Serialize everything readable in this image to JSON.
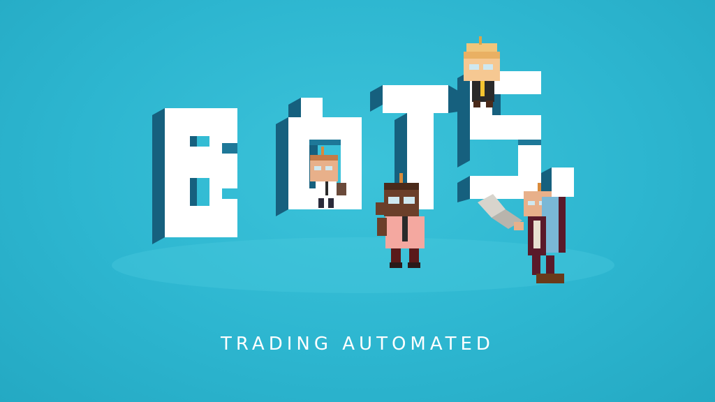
{
  "scene": {
    "logo_word": "BOTS",
    "tagline": "TRADING AUTOMATED"
  },
  "colors": {
    "background": "#2cb7d1",
    "block_face": "#ffffff",
    "block_side": "#16607e",
    "block_top": "#1e7898"
  },
  "characters": [
    {
      "name": "robot-woman-on-top"
    },
    {
      "name": "robot-with-phone"
    },
    {
      "name": "robot-with-glasses"
    },
    {
      "name": "robot-with-laptop"
    }
  ]
}
